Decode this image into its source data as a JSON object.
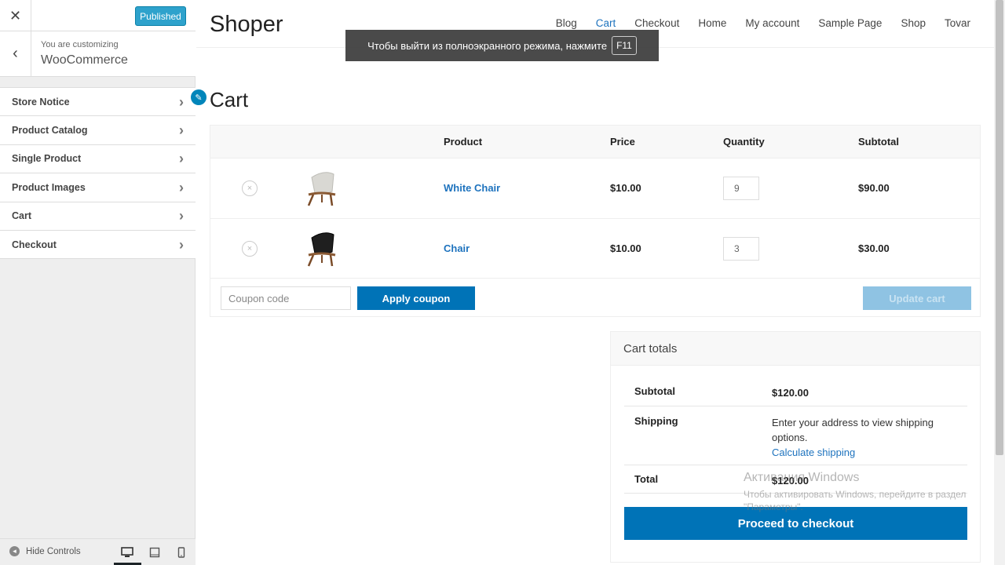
{
  "sidebar": {
    "close_icon": "close-icon",
    "publish_label": "Published",
    "subtitle": "You are customizing",
    "title": "WooCommerce",
    "items": [
      {
        "label": "Store Notice"
      },
      {
        "label": "Product Catalog"
      },
      {
        "label": "Single Product"
      },
      {
        "label": "Product Images"
      },
      {
        "label": "Cart"
      },
      {
        "label": "Checkout"
      }
    ],
    "hide_controls": "Hide Controls",
    "devices": [
      "desktop-icon",
      "tablet-icon",
      "mobile-icon"
    ]
  },
  "site": {
    "brand": "Shoper",
    "nav": [
      {
        "label": "Blog",
        "active": false
      },
      {
        "label": "Cart",
        "active": true
      },
      {
        "label": "Checkout",
        "active": false
      },
      {
        "label": "Home",
        "active": false
      },
      {
        "label": "My account",
        "active": false
      },
      {
        "label": "Sample Page",
        "active": false
      },
      {
        "label": "Shop",
        "active": false
      },
      {
        "label": "Tovar",
        "active": false
      }
    ],
    "page_title": "Cart"
  },
  "fullscreen_toast": {
    "text": "Чтобы выйти из полноэкранного режима, нажмите",
    "key": "F11"
  },
  "cart": {
    "headers": {
      "product": "Product",
      "price": "Price",
      "quantity": "Quantity",
      "subtotal": "Subtotal"
    },
    "rows": [
      {
        "name": "White Chair",
        "price": "$10.00",
        "quantity": "9",
        "subtotal": "$90.00",
        "seat_color": "#d9d8d3"
      },
      {
        "name": "Chair",
        "price": "$10.00",
        "quantity": "3",
        "subtotal": "$30.00",
        "seat_color": "#1f1f1f"
      }
    ],
    "coupon_placeholder": "Coupon code",
    "apply_label": "Apply coupon",
    "update_label": "Update cart"
  },
  "totals": {
    "heading": "Cart totals",
    "subtotal_label": "Subtotal",
    "subtotal_value": "$120.00",
    "shipping_label": "Shipping",
    "shipping_text": "Enter your address to view shipping options.",
    "shipping_link": "Calculate shipping",
    "total_label": "Total",
    "total_value": "$120.00",
    "checkout_label": "Proceed to checkout"
  },
  "watermark": {
    "title": "Активация Windows",
    "subtitle": "Чтобы активировать Windows, перейдите в раздел \"Параметры\"."
  },
  "colors": {
    "accent": "#0073b7",
    "link": "#1e73be",
    "publish": "#2ea2cc"
  }
}
